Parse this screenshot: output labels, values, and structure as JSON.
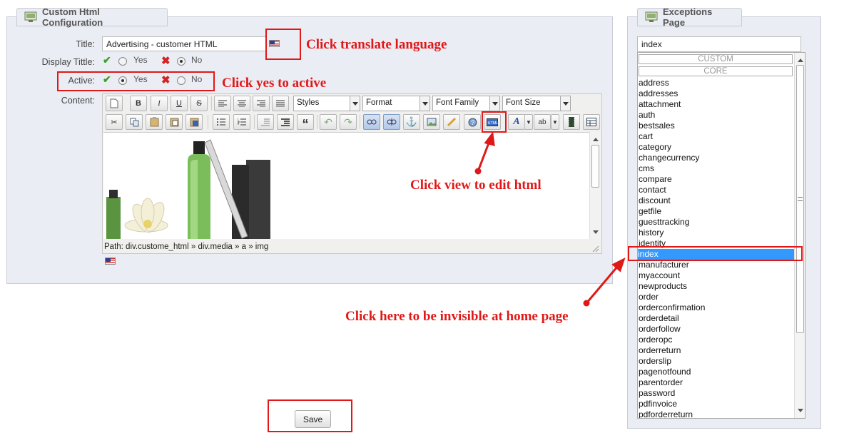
{
  "left_panel": {
    "title": "Custom Html Configuration",
    "title_label": "Title:",
    "title_value": "Advertising - customer HTML",
    "display_title_label": "Display Tittle:",
    "display_yes": "Yes",
    "display_no": "No",
    "display_selected": "No",
    "active_label": "Active:",
    "active_yes": "Yes",
    "active_no": "No",
    "active_selected": "Yes",
    "content_label": "Content:"
  },
  "editor": {
    "styles_label": "Styles",
    "format_label": "Format",
    "font_family_label": "Font Family",
    "font_size_label": "Font Size",
    "path_text": "Path: div.custome_html » div.media » a » img",
    "toolbar_row1": [
      "new-document-icon",
      "bold-icon",
      "italic-icon",
      "underline-icon",
      "strikethrough-icon",
      "align-left-icon",
      "align-center-icon",
      "align-right-icon",
      "align-justify-icon"
    ],
    "toolbar_row2": [
      "cut-icon",
      "copy-icon",
      "paste-icon",
      "paste-text-icon",
      "paste-word-icon",
      "bullet-list-icon",
      "numbered-list-icon",
      "outdent-icon",
      "indent-icon",
      "blockquote-icon",
      "undo-icon",
      "redo-icon",
      "link-icon",
      "unlink-icon",
      "anchor-icon",
      "image-icon",
      "cleanup-icon",
      "help-icon",
      "html-source-icon",
      "text-color-icon",
      "background-color-icon",
      "media-icon",
      "table-icon"
    ]
  },
  "right_panel": {
    "title": "Exceptions Page",
    "search_value": "index",
    "group_custom": "CUSTOM",
    "group_core": "CORE",
    "items": [
      "address",
      "addresses",
      "attachment",
      "auth",
      "bestsales",
      "cart",
      "category",
      "changecurrency",
      "cms",
      "compare",
      "contact",
      "discount",
      "getfile",
      "guesttracking",
      "history",
      "identity",
      "index",
      "manufacturer",
      "myaccount",
      "newproducts",
      "order",
      "orderconfirmation",
      "orderdetail",
      "orderfollow",
      "orderopc",
      "orderreturn",
      "orderslip",
      "pagenotfound",
      "parentorder",
      "password",
      "pdfinvoice",
      "pdforderreturn"
    ],
    "selected_item": "index"
  },
  "save_button": "Save",
  "annotations": {
    "translate": "Click translate language",
    "active": "Click yes to active",
    "view_html": "Click view to edit html",
    "invisible": "Click here to be invisible at home page"
  },
  "colors": {
    "annotation": "#e01818",
    "panel_bg": "#ebedf4",
    "selected_bg": "#3399ff",
    "check": "#3aa12b",
    "cross": "#d42222"
  }
}
